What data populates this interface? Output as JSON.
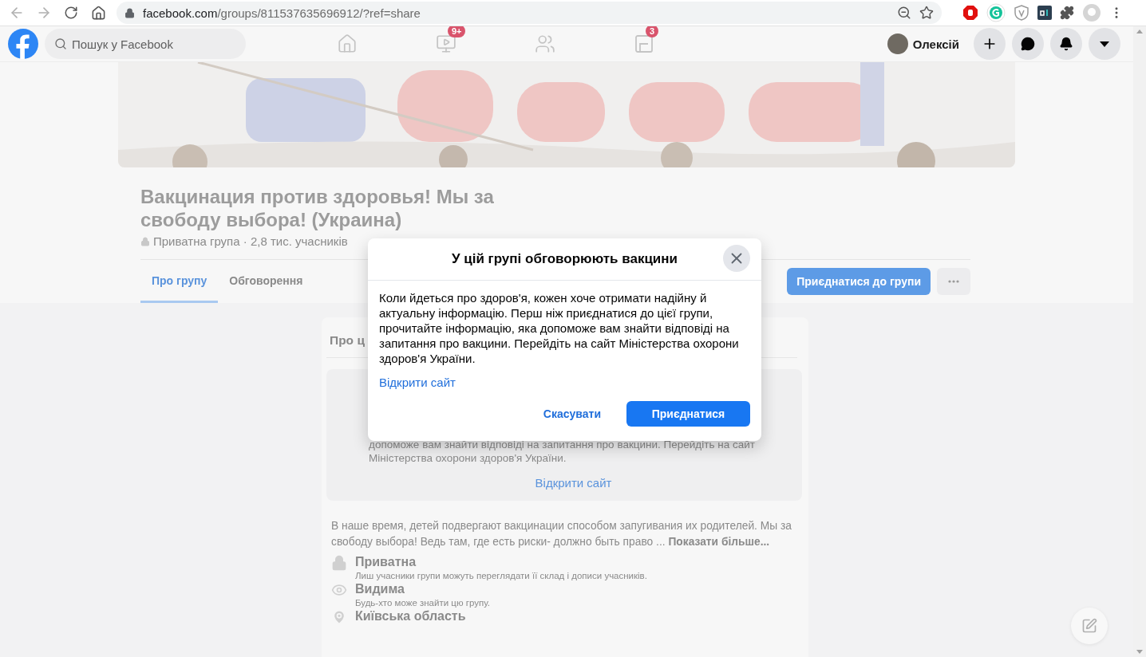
{
  "browser": {
    "url_host": "facebook.com",
    "url_path": "/groups/811537635696912/?ref=share"
  },
  "header": {
    "search": {
      "placeholder": "Пошук у Facebook"
    },
    "nav": [
      {
        "kind": "home"
      },
      {
        "kind": "video",
        "badge": "9+"
      },
      {
        "kind": "groups"
      },
      {
        "kind": "gaming",
        "badge": "3"
      }
    ],
    "user": {
      "name": "Олексій"
    }
  },
  "group": {
    "title": "Вакцинация против здоровья! Мы за свободу выбора! (Украина)",
    "privacy": "Приватна група · 2,8 тис. учасників",
    "tabs": [
      {
        "label": "Про групу",
        "selected": true
      },
      {
        "label": "Обговорення",
        "selected": false
      }
    ],
    "join_button": "Приєднатися до групи"
  },
  "about": {
    "heading": "Про ц",
    "notice": {
      "text": "допоможе вам знайти відповіді на запитання про вакцини. Перейдіть на сайт Міністерства охорони здоров'я України.",
      "link": "Відкрити сайт"
    },
    "description": "В наше время, детей подвергают вакцинации способом запугивания их родителей. Мы за свободу выбора! Ведь там, где есть риски- должно быть право ... **Показати більше...**",
    "facts": [
      {
        "kind": "lock",
        "title": "Приватна",
        "detail": "Лиш учасники групи можуть переглядати її склад і дописи учасників."
      },
      {
        "kind": "eye",
        "title": "Видима",
        "detail": "Будь-хто може знайти цю групу."
      },
      {
        "kind": "pin",
        "title": "Київська область"
      }
    ]
  },
  "dialog": {
    "title": "У цій групі обговорюють вакцини",
    "body": "Коли йдеться про здоров'я, кожен хоче отримати надійну й актуальну інформацію. Перш ніж приєднатися до цієї групи, прочитайте інформацію, яка допоможе вам знайти відповіді на запитання про вакцини. Перейдіть на сайт Міністерства охорони здоров'я України.",
    "link": "Відкрити сайт",
    "buttons": [
      {
        "kind": "secondary",
        "label": "Скасувати"
      },
      {
        "kind": "primary",
        "label": "Приєднатися"
      }
    ]
  }
}
